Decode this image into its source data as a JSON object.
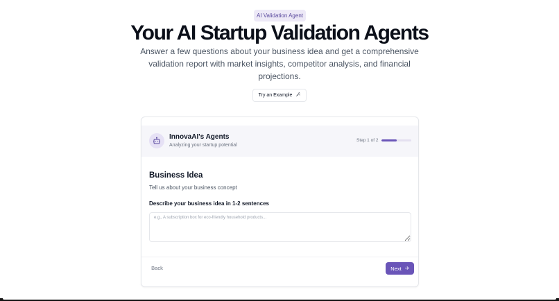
{
  "hero": {
    "badge": "AI Validation Agent",
    "title": "Your AI Startup Validation Agents",
    "subtitle": "Answer a few questions about your business idea and get a comprehensive validation report with market insights, competitor analysis, and financial projections.",
    "try_example_label": "Try an Example"
  },
  "card": {
    "agent_name": "InnovaAI's Agents",
    "agent_desc": "Analyzing your startup potential",
    "step_text": "Step 1 of 2",
    "progress_fraction": 0.5,
    "section_title": "Business Idea",
    "section_desc": "Tell us about your business concept",
    "field_label": "Describe your business idea in 1-2 sentences",
    "field_placeholder": "e.g., A subscription box for eco-friendly household products...",
    "field_value": "",
    "back_label": "Back",
    "next_label": "Next"
  },
  "colors": {
    "accent": "#6a55b8",
    "badge_bg": "#ede9f7",
    "header_bg": "#f6f6fa"
  },
  "icons": {
    "try_example": "magic-wand-icon",
    "agent": "robot-icon",
    "next": "arrow-right-icon"
  }
}
